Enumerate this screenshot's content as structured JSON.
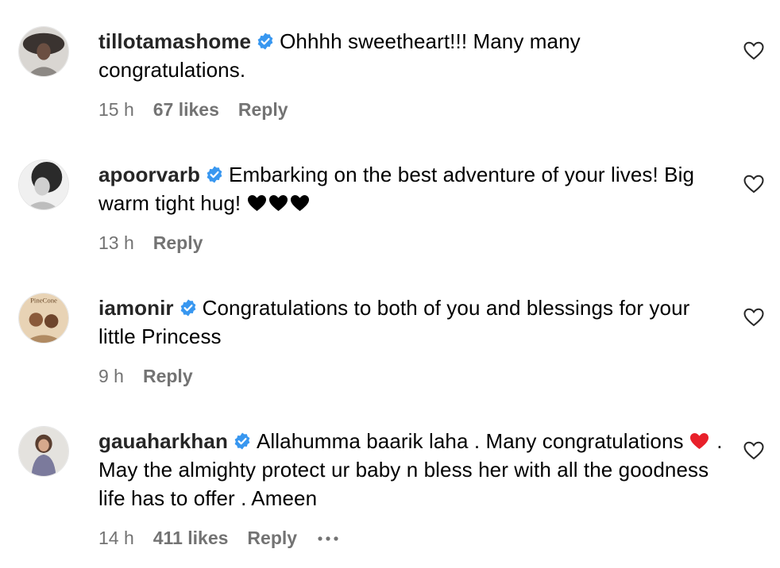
{
  "comments": [
    {
      "username": "tillotamashome",
      "verified": true,
      "text": "Ohhhh sweetheart!!! Many many congratulations.",
      "time": "15 h",
      "likes": "67 likes",
      "reply_label": "Reply"
    },
    {
      "username": "apoorvarb",
      "verified": true,
      "text": "Embarking on the best adventure of your lives! Big warm tight hug!",
      "emoji": [
        "black-heart-emoji",
        "black-heart-emoji",
        "black-heart-emoji"
      ],
      "time": "13 h",
      "reply_label": "Reply"
    },
    {
      "username": "iamonir",
      "verified": true,
      "text": "Congratulations to both of you and blessings for your little Princess",
      "time": "9 h",
      "reply_label": "Reply",
      "avatar_text": "PineCone"
    },
    {
      "username": "gauaharkhan",
      "verified": true,
      "text_before_emoji": "Allahumma baarik laha . Many congratulations",
      "emoji": "red-heart-emoji",
      "text_after_emoji": ". May the almighty protect ur baby n bless her with all the goodness life has to offer . Ameen",
      "time": "14 h",
      "likes": "411 likes",
      "reply_label": "Reply",
      "more_icon": "more-options-icon"
    }
  ],
  "colors": {
    "verified_badge": "#3897f0",
    "meta_text": "#737373",
    "username": "#262626",
    "red_heart": "#e8202a"
  }
}
